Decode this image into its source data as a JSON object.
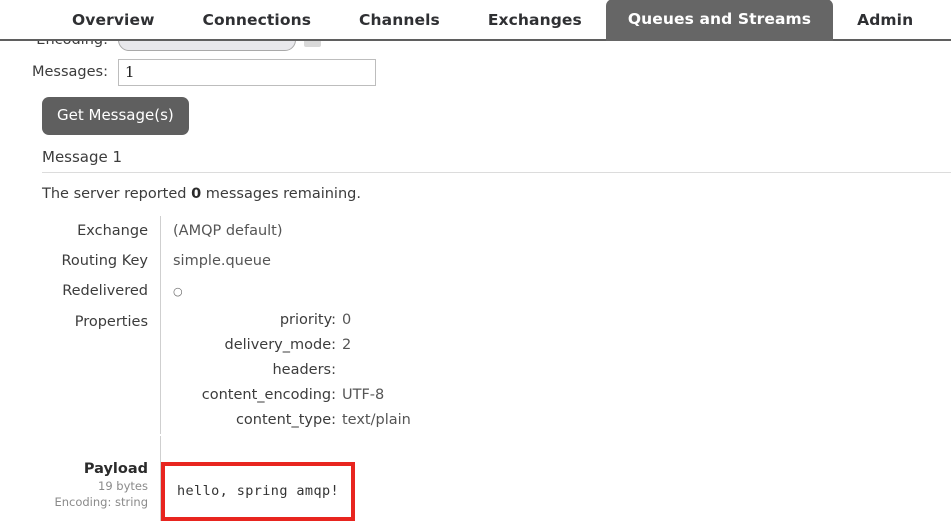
{
  "nav": {
    "items": [
      {
        "label": "Overview",
        "active": false
      },
      {
        "label": "Connections",
        "active": false
      },
      {
        "label": "Channels",
        "active": false
      },
      {
        "label": "Exchanges",
        "active": false
      },
      {
        "label": "Queues and Streams",
        "active": true
      },
      {
        "label": "Admin",
        "active": false
      }
    ]
  },
  "form": {
    "encoding_label": "Encoding:",
    "encoding_value": "",
    "messages_label": "Messages:",
    "messages_value": "1",
    "get_messages_button": "Get Message(s)"
  },
  "message": {
    "heading": "Message 1",
    "remaining_prefix": "The server reported ",
    "remaining_count": "0",
    "remaining_suffix": " messages remaining.",
    "exchange_label": "Exchange",
    "exchange_value": "(AMQP default)",
    "routing_key_label": "Routing Key",
    "routing_key_value": "simple.queue",
    "redelivered_label": "Redelivered",
    "redelivered_value": "○",
    "properties_label": "Properties",
    "properties": [
      {
        "key": "priority:",
        "value": "0"
      },
      {
        "key": "delivery_mode:",
        "value": "2"
      },
      {
        "key": "headers:",
        "value": ""
      },
      {
        "key": "content_encoding:",
        "value": "UTF-8"
      },
      {
        "key": "content_type:",
        "value": "text/plain"
      }
    ],
    "payload_label": "Payload",
    "payload_bytes": "19 bytes",
    "payload_encoding": "Encoding: string",
    "payload_text": "hello, spring amqp!"
  },
  "colors": {
    "active_tab_bg": "#666666",
    "button_bg": "#5f5f5f",
    "highlight_border": "#e8251f",
    "nav_border": "#5f5f5f"
  }
}
